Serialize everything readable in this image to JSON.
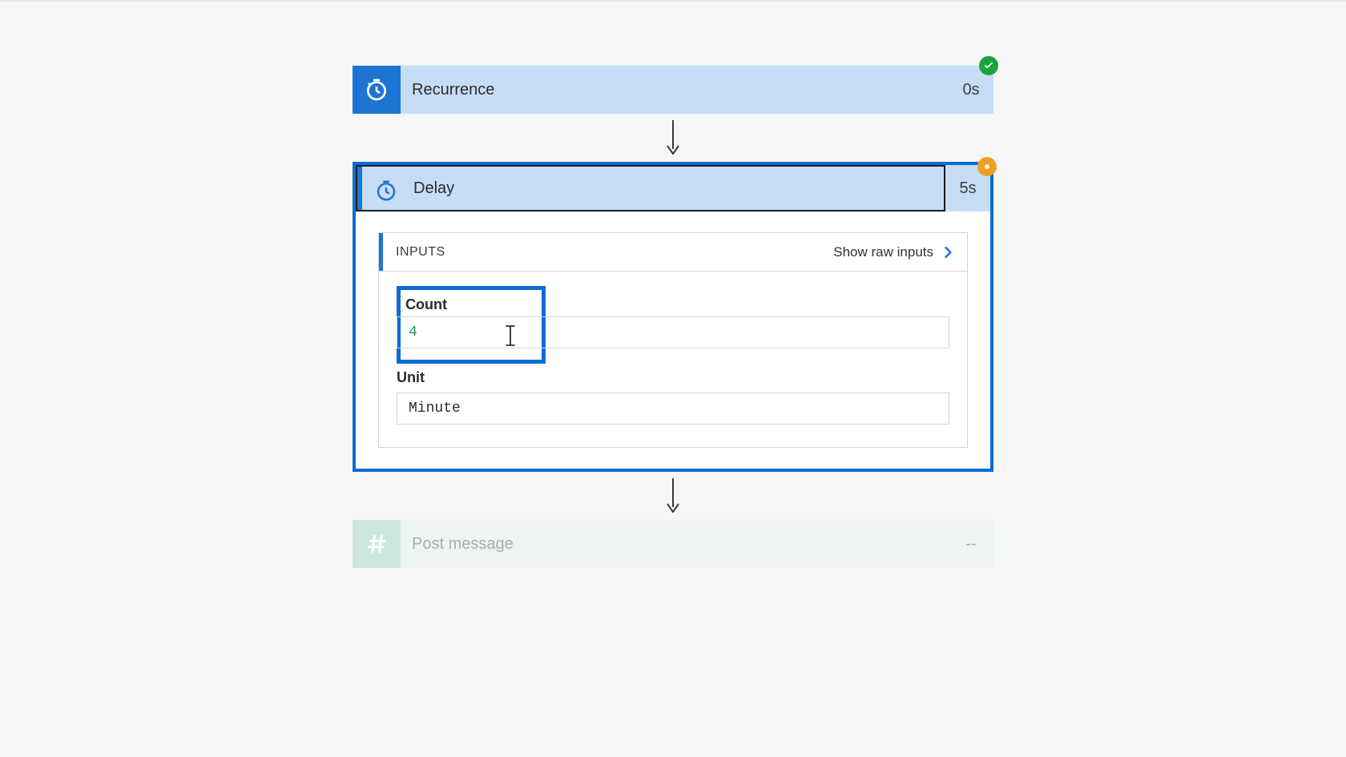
{
  "steps": {
    "recurrence": {
      "title": "Recurrence",
      "duration": "0s",
      "status": "success"
    },
    "delay": {
      "title": "Delay",
      "duration": "5s",
      "status": "running",
      "inputs_label": "INPUTS",
      "show_raw_label": "Show raw inputs",
      "fields": {
        "count": {
          "label": "Count",
          "value": "4"
        },
        "unit": {
          "label": "Unit",
          "value": "Minute"
        }
      }
    },
    "post_message": {
      "title": "Post message",
      "duration": "--"
    }
  }
}
